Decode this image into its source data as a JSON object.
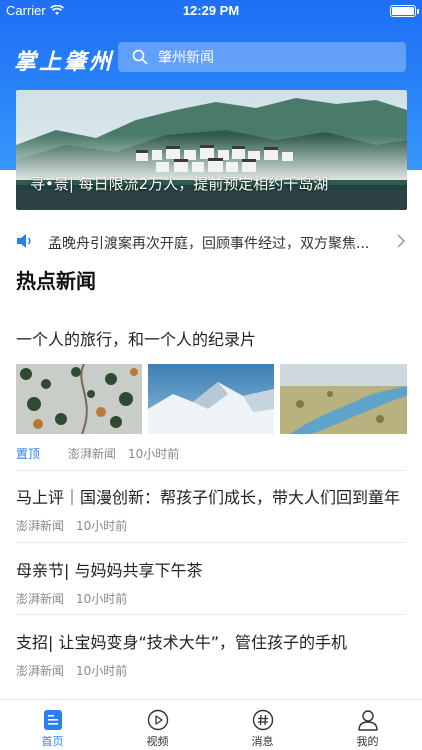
{
  "status_bar": {
    "carrier": "Carrier",
    "time": "12:29 PM"
  },
  "header": {
    "logo_text": "掌上肇州",
    "search_text": "肇州新闻"
  },
  "banner": {
    "caption": "寻•景| 每日限流2万人，提前预定相约千岛湖"
  },
  "notice": {
    "text": "孟晚舟引渡案再次开庭，回顾事件经过，双方聚焦..."
  },
  "hot_news": {
    "section_title": "热点新闻",
    "articles": [
      {
        "title": "一个人的旅行，和一个人的纪录片",
        "tag": "置顶",
        "source": "澎湃新闻",
        "time": "10小时前"
      },
      {
        "title": "马上评｜国漫创新：帮孩子们成长，带大人们回到童年",
        "source": "澎湃新闻",
        "time": "10小时前"
      },
      {
        "title": "母亲节| 与妈妈共享下午茶",
        "source": "澎湃新闻",
        "time": "10小时前"
      },
      {
        "title": "支招| 让宝妈变身“技术大牛”，管住孩子的手机",
        "source": "澎湃新闻",
        "time": "10小时前"
      }
    ]
  },
  "tab_bar": {
    "tabs": [
      {
        "label": "首页",
        "icon": "home-icon",
        "active": true
      },
      {
        "label": "视频",
        "icon": "play-icon",
        "active": false
      },
      {
        "label": "消息",
        "icon": "message-icon",
        "active": false
      },
      {
        "label": "我的",
        "icon": "profile-icon",
        "active": false
      }
    ]
  },
  "colors": {
    "brand_blue": "#2b7ff5",
    "header_gradient_top": "#1f6ff5",
    "header_gradient_bottom": "#3a97fb"
  }
}
